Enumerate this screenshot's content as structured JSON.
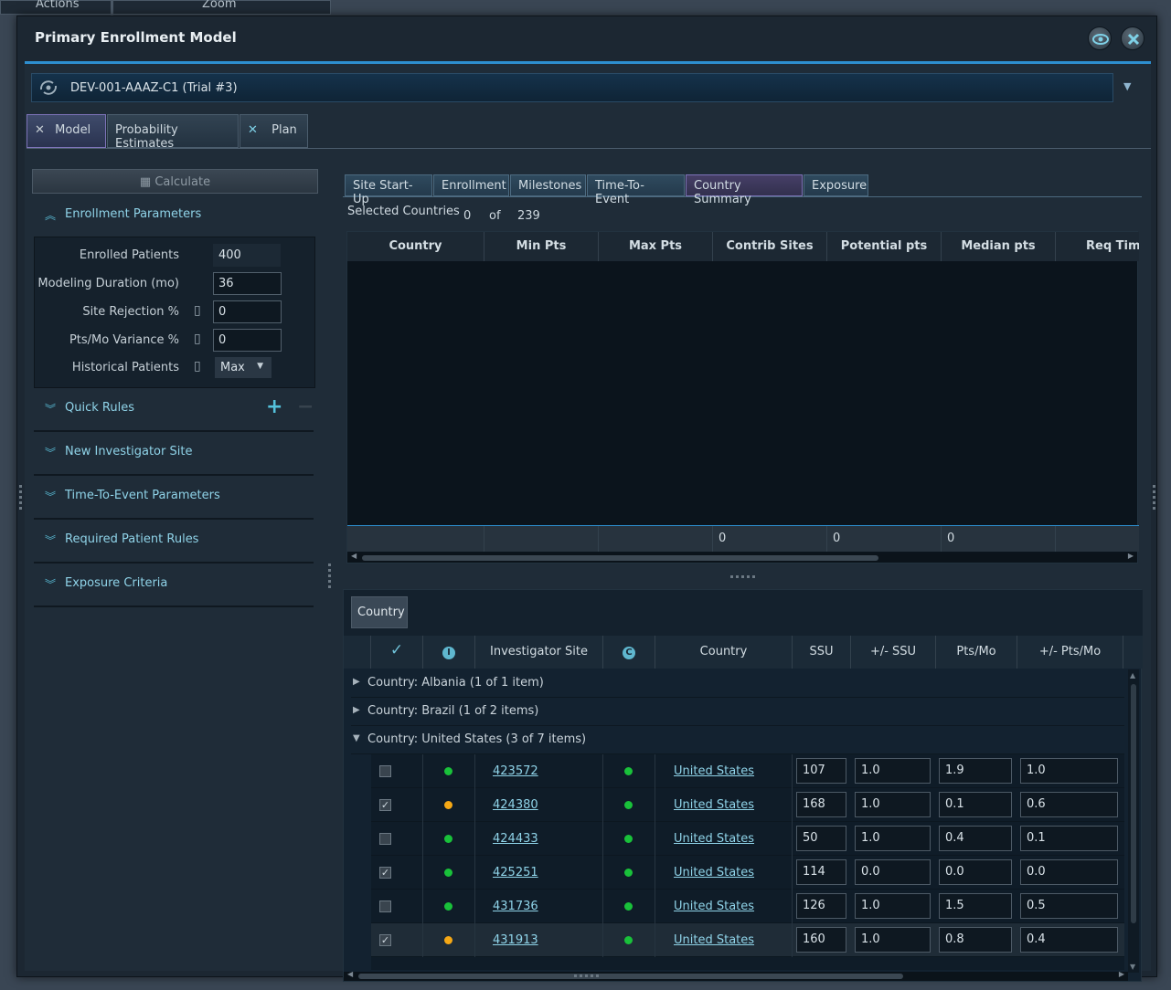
{
  "background_app": {
    "menu": [
      "Actions",
      "Zoom"
    ]
  },
  "dialog": {
    "title": "Primary Enrollment Model"
  },
  "trial_selector": {
    "value": "DEV-001-AAAZ-C1  (Trial #3)"
  },
  "main_tabs": [
    {
      "label": "Model",
      "active": true
    },
    {
      "label": "Probability Estimates",
      "active": false
    },
    {
      "label": "Plan",
      "active": false
    }
  ],
  "left_panel": {
    "calculate_label": "Calculate",
    "enrollment_parameters": {
      "title": "Enrollment Parameters",
      "enrolled_patients": {
        "label": "Enrolled Patients",
        "value": "400"
      },
      "modeling_duration": {
        "label": "Modeling Duration (mo)",
        "value": "36"
      },
      "site_rejection": {
        "label": "Site Rejection %",
        "value": "0"
      },
      "pts_mo_variance": {
        "label": "Pts/Mo Variance %",
        "value": "0"
      },
      "historical_patients": {
        "label": "Historical Patients",
        "value": "Max"
      }
    },
    "sections": [
      "Quick Rules",
      "New Investigator Site",
      "Time-To-Event Parameters",
      "Required Patient Rules",
      "Exposure Criteria"
    ]
  },
  "sub_tabs": [
    {
      "label": "Site Start-Up",
      "active": false
    },
    {
      "label": "Enrollment",
      "active": false
    },
    {
      "label": "Milestones",
      "active": false
    },
    {
      "label": "Time-To-Event",
      "active": false
    },
    {
      "label": "Country Summary",
      "active": true
    },
    {
      "label": "Exposure",
      "active": false
    }
  ],
  "selected_countries": {
    "label": "Selected Countries",
    "count": "0",
    "of": "of",
    "total": "239"
  },
  "country_summary_grid": {
    "headers": [
      "Country",
      "Min Pts",
      "Max Pts",
      "Contrib Sites",
      "Potential pts",
      "Median pts",
      "Req Time"
    ],
    "footer": [
      "",
      "",
      "",
      "0",
      "0",
      "0",
      ""
    ]
  },
  "site_grid": {
    "group_button": "Country",
    "headers": {
      "investigator_site": "Investigator Site",
      "country": "Country",
      "ssu": "SSU",
      "ssu_var": "+/- SSU",
      "pts_mo": "Pts/Mo",
      "pts_mo_var": "+/- Pts/Mo"
    },
    "groups": [
      {
        "label": "Country: Albania (1 of 1 item)",
        "expanded": false
      },
      {
        "label": "Country: Brazil (1 of 2 items)",
        "expanded": false
      },
      {
        "label": "Country: United States (3 of 7 items)",
        "expanded": true
      }
    ],
    "rows": [
      {
        "checked": "",
        "status": "green",
        "site": "423572",
        "c_status": "green",
        "country": "United States",
        "ssu": "107",
        "ssu_var": "1.0",
        "pts_mo": "1.9",
        "pts_mo_var": "1.0"
      },
      {
        "checked": "✓",
        "status": "orange",
        "site": "424380",
        "c_status": "green",
        "country": "United States",
        "ssu": "168",
        "ssu_var": "1.0",
        "pts_mo": "0.1",
        "pts_mo_var": "0.6"
      },
      {
        "checked": "",
        "status": "green",
        "site": "424433",
        "c_status": "green",
        "country": "United States",
        "ssu": "50",
        "ssu_var": "1.0",
        "pts_mo": "0.4",
        "pts_mo_var": "0.1"
      },
      {
        "checked": "✓",
        "status": "green",
        "site": "425251",
        "c_status": "green",
        "country": "United States",
        "ssu": "114",
        "ssu_var": "0.0",
        "pts_mo": "0.0",
        "pts_mo_var": "0.0"
      },
      {
        "checked": "",
        "status": "green",
        "site": "431736",
        "c_status": "green",
        "country": "United States",
        "ssu": "126",
        "ssu_var": "1.0",
        "pts_mo": "1.5",
        "pts_mo_var": "0.5"
      },
      {
        "checked": "✓",
        "status": "orange",
        "site": "431913",
        "c_status": "green",
        "country": "United States",
        "ssu": "160",
        "ssu_var": "1.0",
        "pts_mo": "0.8",
        "pts_mo_var": "0.4"
      }
    ]
  },
  "colors": {
    "accent": "#2d8fd0",
    "link": "#8fd3e8",
    "green": "#19c13a",
    "orange": "#f5a815"
  }
}
